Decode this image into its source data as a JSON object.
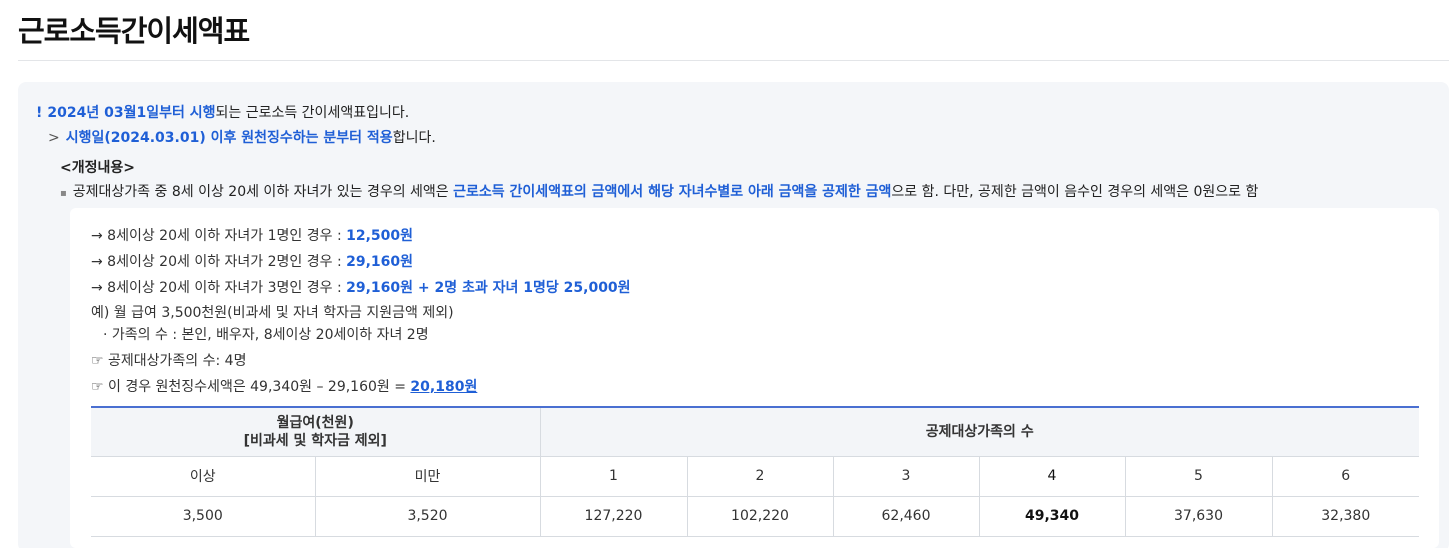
{
  "page": {
    "title": "근로소득간이세액표"
  },
  "notice": {
    "line1": {
      "mark": "!",
      "highlight": "2024년 03월1일부터 시행",
      "rest": "되는 근로소득 간이세액표입니다."
    },
    "line2": {
      "mark": ">",
      "highlight": "시행일(2024.03.01) 이후 원천징수하는 분부터 적용",
      "rest": "합니다."
    },
    "section_title": "<개정내용>",
    "revision": {
      "prefix": "공제대상가족 중 8세 이상 20세 이하 자녀가 있는 경우의 세액은 ",
      "highlight": "근로소득 간이세액표의 금액에서 해당 자녀수별로 아래 금액을 공제한 금액",
      "suffix": "으로 함. 다만, 공제한 금액이 음수인 경우의 세액은 0원으로 함"
    }
  },
  "deductions": [
    {
      "label": "→ 8세이상 20세 이하 자녀가 1명인 경우 : ",
      "amount": "12,500원"
    },
    {
      "label": "→ 8세이상 20세 이하 자녀가 2명인 경우 : ",
      "amount": "29,160원"
    },
    {
      "label": "→ 8세이상 20세 이하 자녀가 3명인 경우 : ",
      "amount": "29,160원 + 2명 초과 자녀 1명당 25,000원"
    }
  ],
  "example": {
    "line1": "예) 월 급여 3,500천원(비과세 및 자녀 학자금 지원금액 제외)",
    "line2": "· 가족의 수 : 본인, 배우자, 8세이상 20세이하 자녀 2명",
    "line3": "☞ 공제대상가족의 수: 4명",
    "line4_prefix": "☞ 이 경우 원천징수세액은 49,340원 – 29,160원 = ",
    "line4_result": "20,180원"
  },
  "table": {
    "salary_header_line1": "월급여(천원)",
    "salary_header_line2": "[비과세 및 학자금 제외]",
    "family_header": "공제대상가족의 수",
    "sub_headers": [
      "이상",
      "미만",
      "1",
      "2",
      "3",
      "4",
      "5",
      "6"
    ],
    "rows": [
      [
        "3,500",
        "3,520",
        "127,220",
        "102,220",
        "62,460",
        "49,340",
        "37,630",
        "32,380"
      ]
    ],
    "highlight_column": 5
  }
}
